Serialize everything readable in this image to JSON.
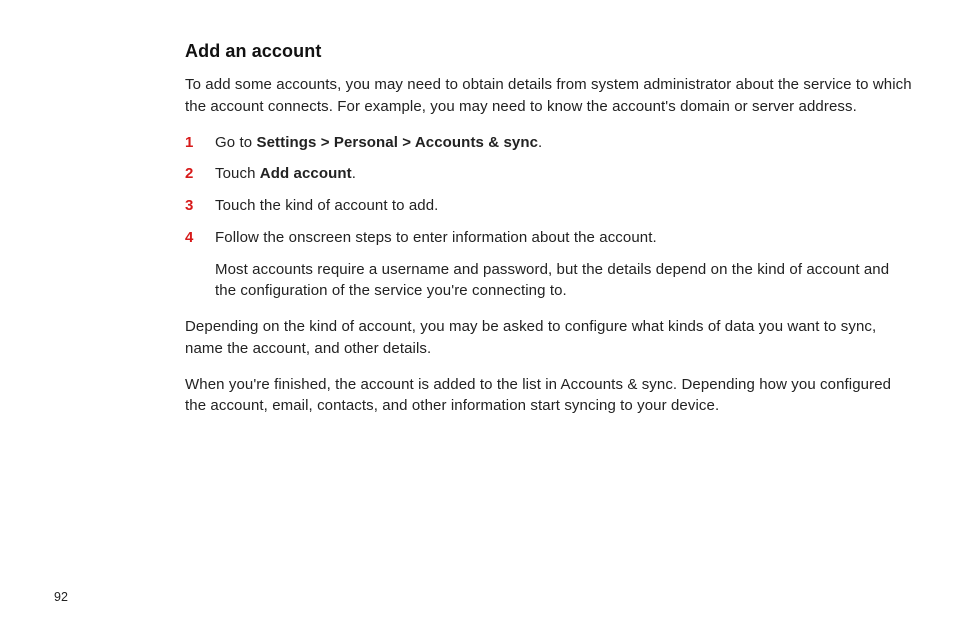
{
  "title": "Add an account",
  "intro": "To add some accounts, you may need to obtain details from system administrator about the service to which the account connects. For example, you may need to know the account's domain or server address.",
  "steps": [
    {
      "num": "1",
      "pre": "Go to ",
      "bold": "Settings > Personal > Accounts & sync",
      "post": "."
    },
    {
      "num": "2",
      "pre": "Touch ",
      "bold": "Add account",
      "post": "."
    },
    {
      "num": "3",
      "pre": "Touch the kind of account to add.",
      "bold": "",
      "post": ""
    },
    {
      "num": "4",
      "pre": "Follow the onscreen steps to enter information about the account.",
      "bold": "",
      "post": "",
      "extra": "Most accounts require a username and password, but the details depend on the kind of account and the configuration of the service you're connecting to."
    }
  ],
  "outro1": "Depending on the kind of account, you may be asked to configure what kinds of data you want to sync, name the account, and other details.",
  "outro2": "When you're finished, the account is added to the list in Accounts & sync. Depending how you configured the account, email, contacts, and other information start syncing to your device.",
  "page_number": "92"
}
